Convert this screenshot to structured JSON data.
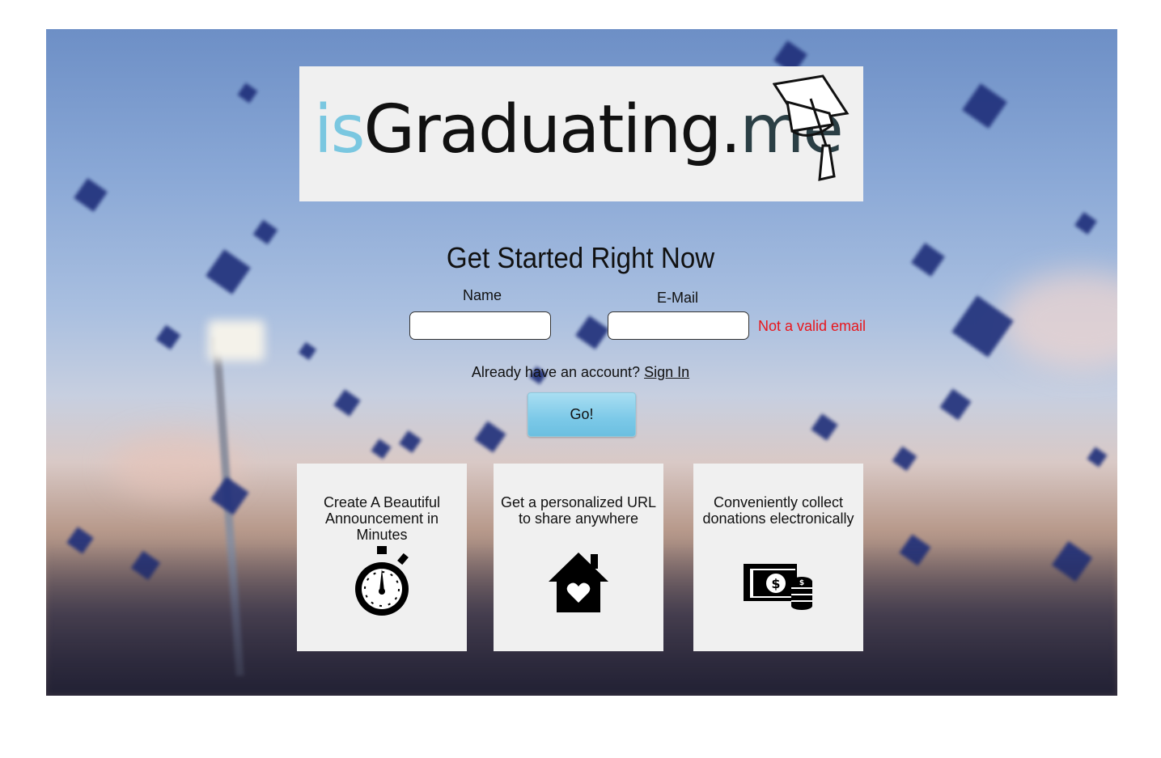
{
  "logo": {
    "part1": "is",
    "part2": "Graduating.",
    "part3": "me",
    "icon": "graduation-cap-icon"
  },
  "signup": {
    "headline": "Get Started Right Now",
    "name_label": "Name",
    "email_label": "E-Mail",
    "name_value": "",
    "email_value": "",
    "email_error": "Not a valid email",
    "account_prompt": "Already have an account?",
    "sign_in_link": "Sign In",
    "go_button": "Go!"
  },
  "features": [
    {
      "text": "Create A Beautiful Announcement in Minutes",
      "icon": "stopwatch-icon"
    },
    {
      "text": "Get a personalized URL to share anywhere",
      "icon": "house-heart-icon"
    },
    {
      "text": "Conveniently collect donations electronically",
      "icon": "money-coins-icon"
    }
  ],
  "colors": {
    "accent": "#7ac7e0",
    "error": "#e8161c",
    "button": "#7cc9e8",
    "card_bg": "#f0f0f0"
  }
}
